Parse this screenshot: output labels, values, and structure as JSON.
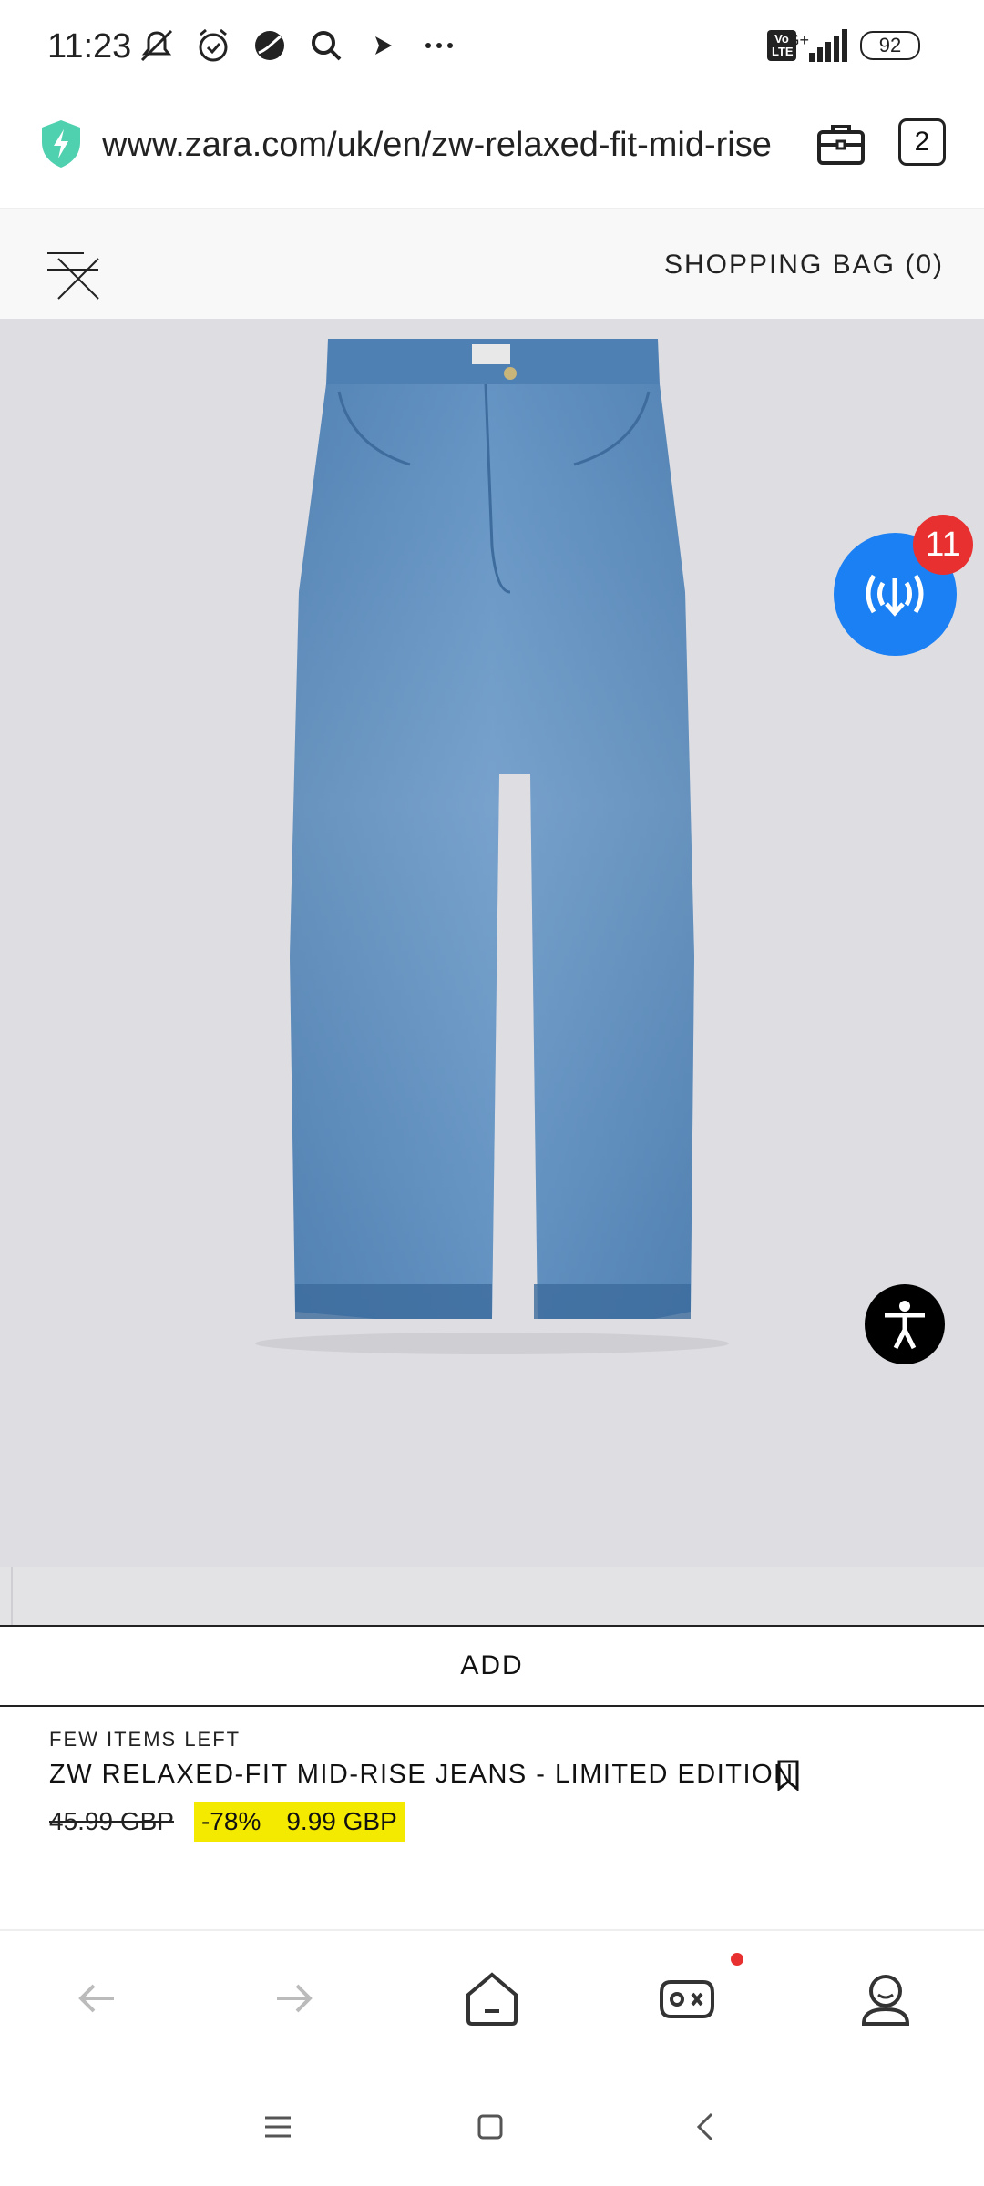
{
  "status_bar": {
    "time": "11:23",
    "network": "4G+",
    "volte": "Vo LTE",
    "battery": "92",
    "icons": [
      "mute-icon",
      "alarm-icon",
      "do-not-disturb-icon",
      "search-icon",
      "play-icon",
      "more-icon"
    ]
  },
  "browser": {
    "url": "www.zara.com/uk/en/zw-relaxed-fit-mid-rise",
    "tab_count": "2"
  },
  "site_header": {
    "shopping_bag": "SHOPPING BAG (0)"
  },
  "floating": {
    "download_badge": "11"
  },
  "product": {
    "add_label": "ADD",
    "stock_note": "FEW ITEMS LEFT",
    "name": "ZW RELAXED-FIT MID-RISE JEANS - LIMITED EDITION",
    "old_price": "45.99 GBP",
    "discount": "-78%",
    "sale_price": "9.99 GBP"
  },
  "colors": {
    "sale_highlight": "#f4ea00",
    "download_button": "#1a80f3",
    "badge": "#e83030"
  }
}
